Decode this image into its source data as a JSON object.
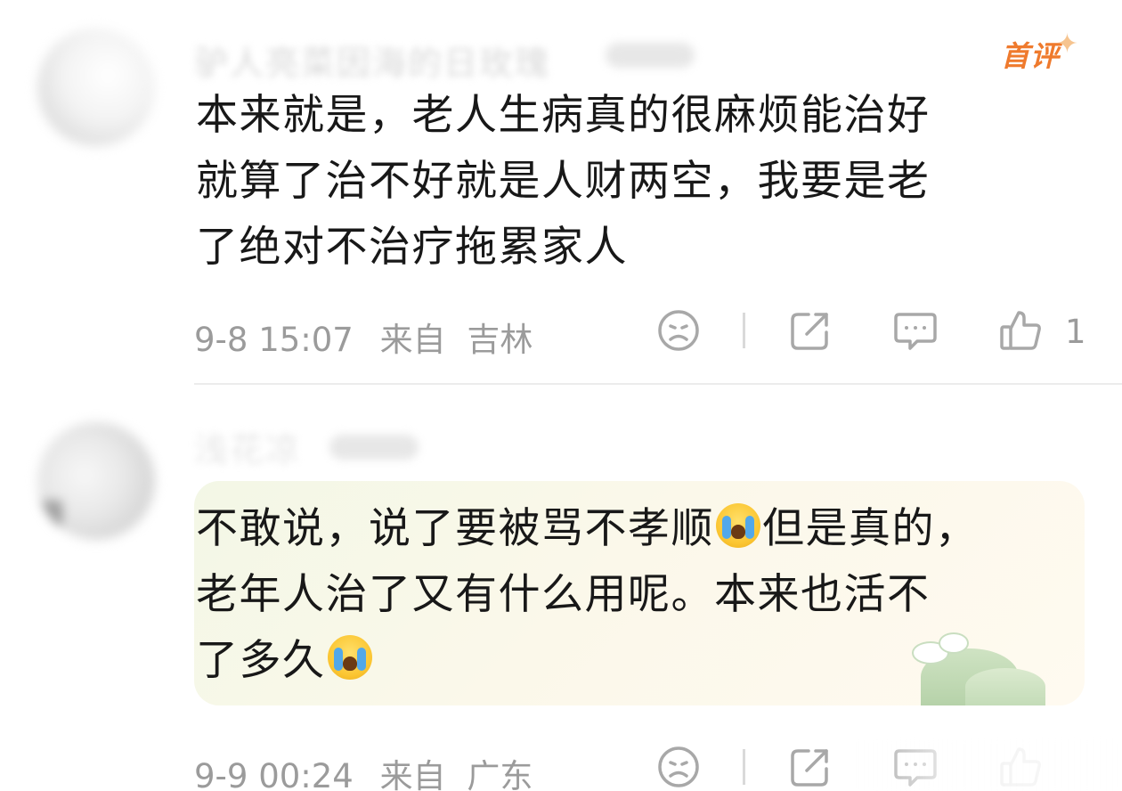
{
  "comments": [
    {
      "username": "驴人亮菜因海的日玫瑰",
      "badge": "首评",
      "content_lines": [
        "本来就是，老人生病真的很麻烦能治好",
        "就算了治不好就是人财两空，我要是老",
        "了绝对不治疗拖累家人"
      ],
      "time": "9-8 15:07",
      "from_label": "来自",
      "location": "吉林",
      "like_count": "1"
    },
    {
      "username": "浅花凉",
      "content_line1_a": "不敢说，说了要被骂不孝顺",
      "content_line1_b": "但是真的，",
      "content_line2": "老年人治了又有什么用呢。本来也活不",
      "content_line3": "了多久",
      "emoji_name": "crying-emoji",
      "time": "9-9 00:24",
      "from_label": "来自",
      "location": "广东",
      "like_count": ""
    }
  ],
  "icons": {
    "dislike": "frown-face-icon",
    "share": "share-icon",
    "comment": "comment-bubble-icon",
    "like": "thumbs-up-icon"
  },
  "colors": {
    "badge_orange": "#ef7a2d",
    "meta_gray": "#9b9b9b",
    "text_dark": "#181818"
  }
}
